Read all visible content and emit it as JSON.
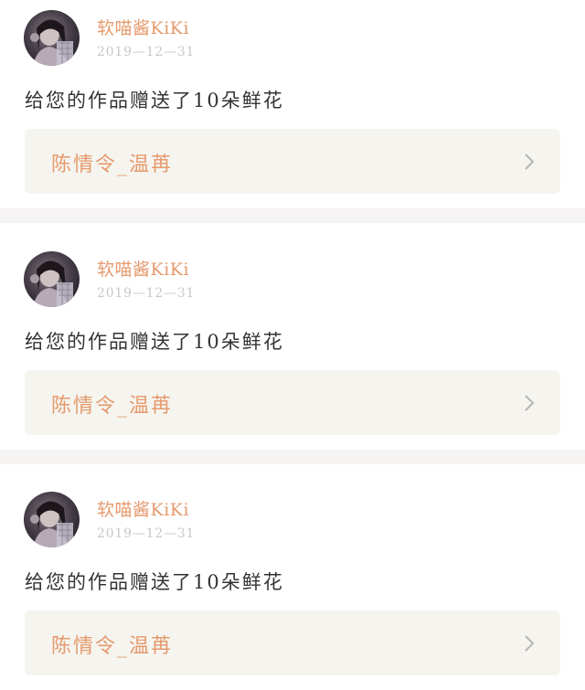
{
  "notifications": [
    {
      "username": "软喵酱KiKi",
      "timestamp": "2019—12—31",
      "message": "给您的作品赠送了10朵鲜花",
      "work_title": "陈情令_温苒",
      "avatar_icon": "user-avatar",
      "chevron_icon": "chevron-right-icon"
    },
    {
      "username": "软喵酱KiKi",
      "timestamp": "2019—12—31",
      "message": "给您的作品赠送了10朵鲜花",
      "work_title": "陈情令_温苒",
      "avatar_icon": "user-avatar",
      "chevron_icon": "chevron-right-icon"
    },
    {
      "username": "软喵酱KiKi",
      "timestamp": "2019—12—31",
      "message": "给您的作品赠送了10朵鲜花",
      "work_title": "陈情令_温苒",
      "avatar_icon": "user-avatar",
      "chevron_icon": "chevron-right-icon"
    }
  ],
  "colors": {
    "accent": "#e59a6d",
    "timestamp": "#c8c8c8",
    "body_text": "#333333",
    "link_bg": "#f5f4ef",
    "divider": "#f6f3f3"
  }
}
